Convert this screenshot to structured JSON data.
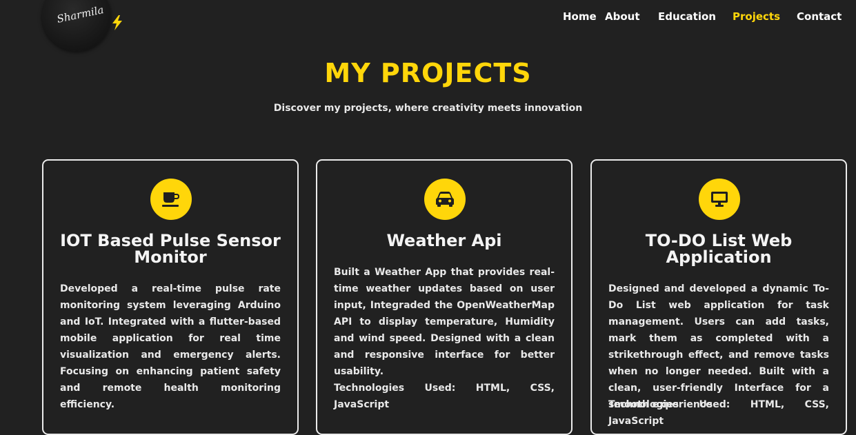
{
  "logo": {
    "text": "Sharmila",
    "bolt_icon": "lightning-icon"
  },
  "nav": {
    "items": [
      {
        "label": "Home",
        "active": false
      },
      {
        "label": "About",
        "active": false
      },
      {
        "label": "Education",
        "active": false
      },
      {
        "label": "Projects",
        "active": true
      },
      {
        "label": "Contact",
        "active": false
      }
    ]
  },
  "section": {
    "title": "MY PROJECTS",
    "subtitle": "Discover my projects, where creativity meets innovation"
  },
  "colors": {
    "accent": "#FFD60A",
    "background": "#212121",
    "card_border": "#ececec"
  },
  "projects": [
    {
      "icon": "coffee-cup-icon",
      "title": "IOT Based Pulse Sensor Monitor",
      "description": "Developed a real-time pulse rate monitoring system leveraging Arduino and IoT. Integrated with a flutter-based mobile application for real time visualization and emergency alerts. Focusing on enhancing patient safety and remote health monitoring efficiency.",
      "technologies": ""
    },
    {
      "icon": "car-icon",
      "title": "Weather Api",
      "description": "Built a Weather App that provides real-time weather updates based on user input, Integraded the OpenWeatherMap API to display temperature, Humidity and wind speed. Designed with a clean and responsive interface for better usability.",
      "technologies": "Technologies Used: HTML, CSS, JavaScript"
    },
    {
      "icon": "desktop-icon",
      "title": "TO-DO List Web Application",
      "description": "Designed and developed a dynamic To-Do List web application for task management. Users can add tasks, mark them as completed with a strikethrough effect, and remove tasks when no longer needed. Built with a clean, user-friendly Interface for a smooth experience",
      "technologies": "Technologies Used: HTML, CSS, JavaScript"
    }
  ]
}
